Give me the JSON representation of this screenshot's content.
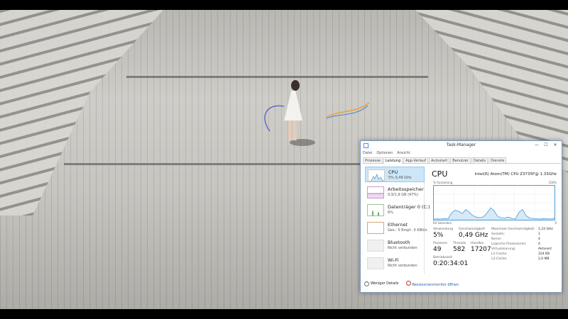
{
  "window": {
    "title": "Task-Manager",
    "minimize_glyph": "—",
    "maximize_glyph": "☐",
    "close_glyph": "✕"
  },
  "menu": [
    "Datei",
    "Optionen",
    "Ansicht"
  ],
  "tabs": [
    {
      "label": "Prozesse",
      "active": false
    },
    {
      "label": "Leistung",
      "active": true
    },
    {
      "label": "App-Verlauf",
      "active": false
    },
    {
      "label": "Autostart",
      "active": false
    },
    {
      "label": "Benutzer",
      "active": false
    },
    {
      "label": "Details",
      "active": false
    },
    {
      "label": "Dienste",
      "active": false
    }
  ],
  "sidebar": {
    "items": [
      {
        "name": "CPU",
        "sub": "5% 0,49 GHz",
        "color": "#4a9bd4",
        "selected": true
      },
      {
        "name": "Arbeitsspeicher",
        "sub": "0,9/1,9 GB (47%)",
        "color": "#a04aa8",
        "selected": false
      },
      {
        "name": "Datenträger 0 (C:)",
        "sub": "6%",
        "color": "#4b9a3a",
        "selected": false
      },
      {
        "name": "Ethernet",
        "sub": "Ges.: 0 Empf.: 0 KBit/s",
        "color": "#b5651d",
        "selected": false
      },
      {
        "name": "Bluetooth",
        "sub": "Nicht verbunden",
        "color": "#bbbbbb",
        "selected": false
      },
      {
        "name": "Wi-Fi",
        "sub": "Nicht verbunden",
        "color": "#bbbbbb",
        "selected": false
      }
    ]
  },
  "cpu": {
    "title": "CPU",
    "model": "Intel(R) Atom(TM) CPU Z3735F@ 1.33GHz",
    "graph_label": "% Auslastung",
    "graph_max": "100%",
    "graph_time": "60 Sekunden",
    "graph_min": "0",
    "usage_series": [
      2,
      3,
      2,
      4,
      3,
      20,
      28,
      25,
      18,
      30,
      22,
      12,
      8,
      6,
      9,
      20,
      35,
      26,
      10,
      6,
      5,
      8,
      4,
      3,
      22,
      30,
      12,
      5,
      4,
      3,
      2,
      4,
      3,
      2,
      5
    ],
    "stats": {
      "usage_label": "Verwendung",
      "usage_value": "5%",
      "speed_label": "Geschwindigkeit",
      "speed_value": "0,49 GHz",
      "processes_label": "Prozesse",
      "processes_value": "49",
      "threads_label": "Threads",
      "threads_value": "582",
      "handles_label": "Handles",
      "handles_value": "17207",
      "uptime_label": "Betriebszeit",
      "uptime_value": "0:20:34:01"
    },
    "details": [
      {
        "label": "Maximale Geschwindigkeit:",
        "value": "1,33 GHz"
      },
      {
        "label": "Sockets:",
        "value": "1"
      },
      {
        "label": "Kerne:",
        "value": "4"
      },
      {
        "label": "Logische Prozessoren:",
        "value": "4"
      },
      {
        "label": "Virtualisierung:",
        "value": "Aktiviert"
      },
      {
        "label": "L1-Cache:",
        "value": "224 KB"
      },
      {
        "label": "L2-Cache:",
        "value": "2,0 MB"
      }
    ]
  },
  "footer": {
    "less_details": "Weniger Details",
    "resource_monitor": "Ressourcenmonitor öffnen"
  }
}
